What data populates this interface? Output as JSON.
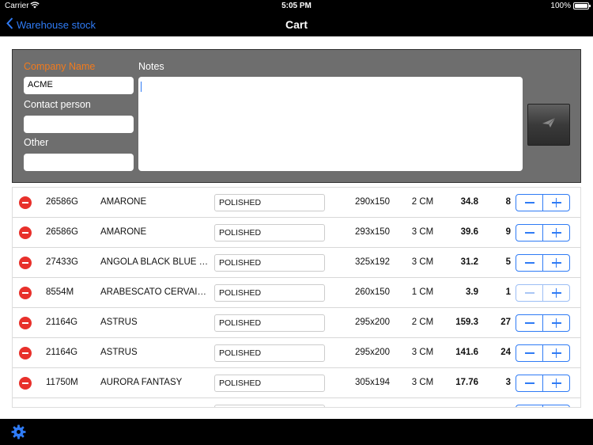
{
  "status": {
    "carrier": "Carrier",
    "time": "5:05 PM",
    "battery": "100%"
  },
  "nav": {
    "back_label": "Warehouse stock",
    "title": "Cart"
  },
  "form": {
    "company_label": "Company Name",
    "company_value": "ACME",
    "contact_label": "Contact person",
    "contact_value": "",
    "other_label": "Other",
    "other_value": "",
    "notes_label": "Notes",
    "notes_value": ""
  },
  "icons": {
    "send": "send-icon",
    "settings": "gear-icon",
    "back": "chevron-left-icon"
  },
  "colors": {
    "accent": "#2f7bf5",
    "delete": "#e8302b",
    "required_label": "#f27a1c"
  },
  "rows": [
    {
      "code": "26586G",
      "name": "AMARONE",
      "finish": "POLISHED",
      "size": "290x150",
      "thickness": "2 CM",
      "price": "34.8",
      "qty": "8"
    },
    {
      "code": "26586G",
      "name": "AMARONE",
      "finish": "POLISHED",
      "size": "293x150",
      "thickness": "3 CM",
      "price": "39.6",
      "qty": "9"
    },
    {
      "code": "27433G",
      "name": "ANGOLA BLACK BLUE M...",
      "finish": "POLISHED",
      "size": "325x192",
      "thickness": "3 CM",
      "price": "31.2",
      "qty": "5"
    },
    {
      "code": "8554M",
      "name": "ARABESCATO CERVAIOLE",
      "finish": "POLISHED",
      "size": "260x150",
      "thickness": "1 CM",
      "price": "3.9",
      "qty": "1"
    },
    {
      "code": "21164G",
      "name": "ASTRUS",
      "finish": "POLISHED",
      "size": "295x200",
      "thickness": "2 CM",
      "price": "159.3",
      "qty": "27"
    },
    {
      "code": "21164G",
      "name": "ASTRUS",
      "finish": "POLISHED",
      "size": "295x200",
      "thickness": "3 CM",
      "price": "141.6",
      "qty": "24"
    },
    {
      "code": "11750M",
      "name": "AURORA FANTASY",
      "finish": "POLISHED",
      "size": "305x194",
      "thickness": "3 CM",
      "price": "17.76",
      "qty": "3"
    }
  ]
}
